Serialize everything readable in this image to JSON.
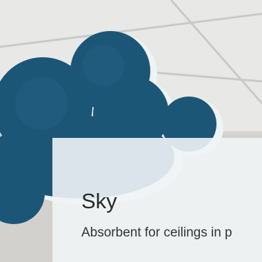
{
  "card": {
    "title": "Sky",
    "subtitle": "Absorbent for ceilings in p"
  },
  "colors": {
    "cloud_blue": "#1c5677",
    "cloud_edge": "#eef3f6",
    "ceiling": "#e6e6e4",
    "overlay": "#f0f4f6"
  }
}
